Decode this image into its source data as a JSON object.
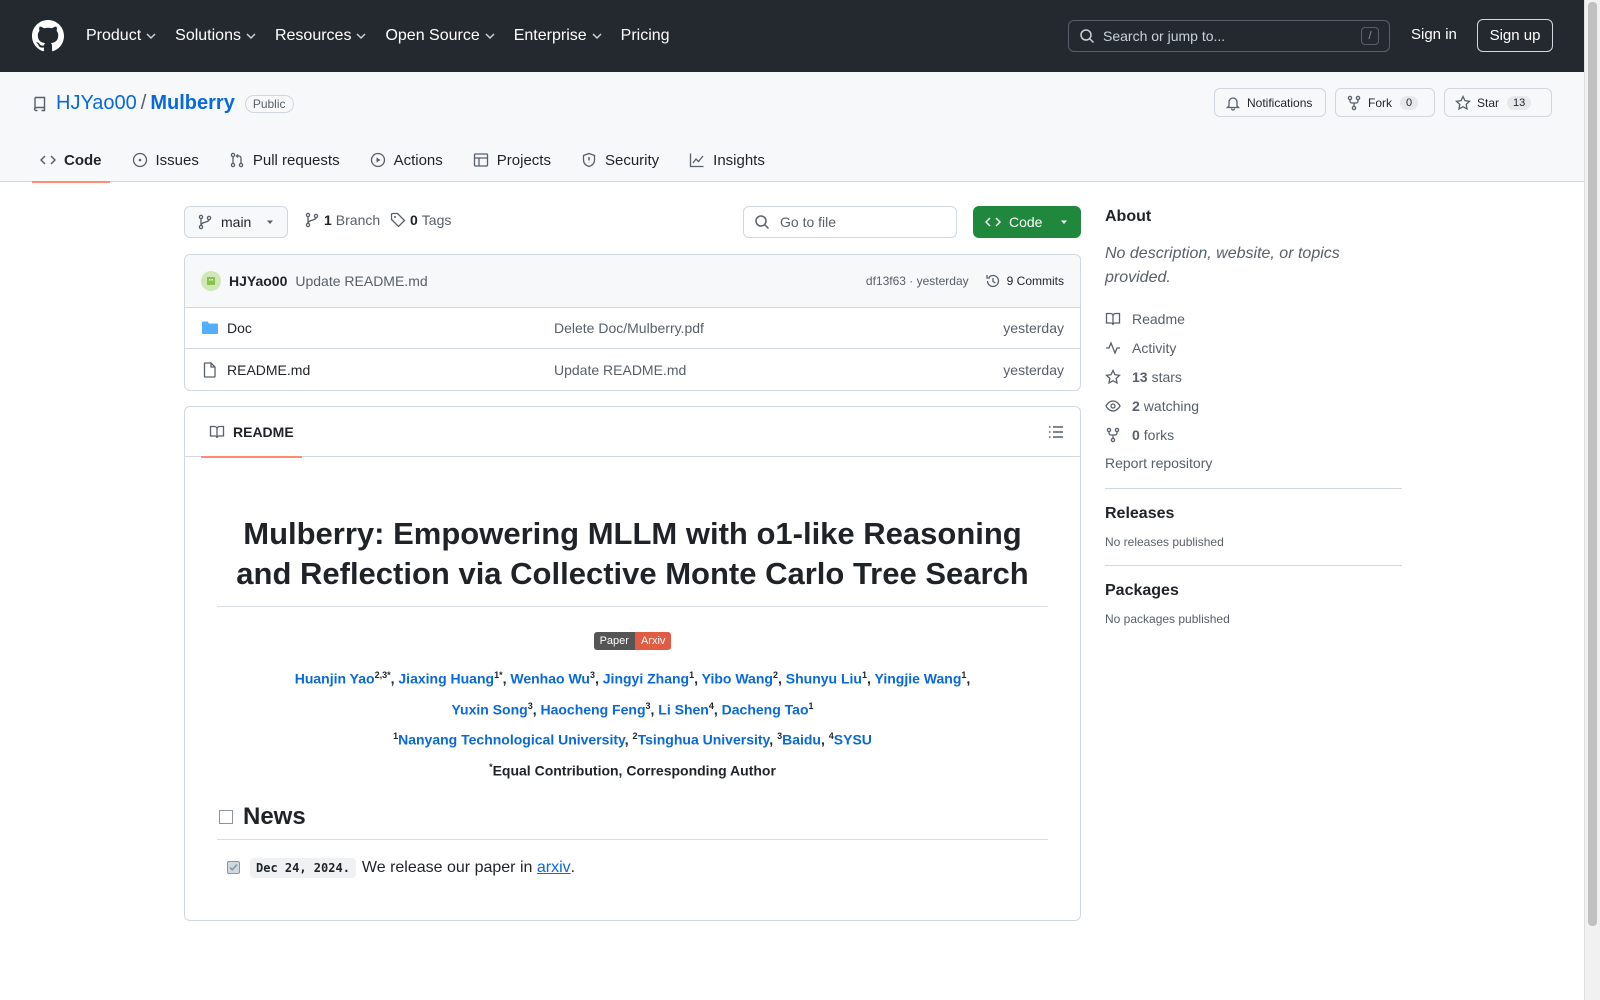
{
  "header": {
    "nav": [
      "Product",
      "Solutions",
      "Resources",
      "Open Source",
      "Enterprise",
      "Pricing"
    ],
    "search_placeholder": "Search or jump to...",
    "search_shortcut": "/",
    "sign_in": "Sign in",
    "sign_up": "Sign up"
  },
  "repo": {
    "owner": "HJYao00",
    "separator": "/",
    "name": "Mulberry",
    "visibility": "Public",
    "notifications_label": "Notifications",
    "fork_label": "Fork",
    "fork_count": "0",
    "star_label": "Star",
    "star_count": "13"
  },
  "tabs": [
    "Code",
    "Issues",
    "Pull requests",
    "Actions",
    "Projects",
    "Security",
    "Insights"
  ],
  "file_nav": {
    "branch": "main",
    "branch_count": "1",
    "branch_label": "Branch",
    "tag_count": "0",
    "tag_label": "Tags",
    "goto_placeholder": "Go to file",
    "code_button": "Code"
  },
  "commit": {
    "author": "HJYao00",
    "message": "Update README.md",
    "hash_time": "df13f63 · yesterday",
    "commits": "9 Commits"
  },
  "files": [
    {
      "name": "Doc",
      "type": "folder",
      "message": "Delete Doc/Mulberry.pdf",
      "date": "yesterday"
    },
    {
      "name": "README.md",
      "type": "file",
      "message": "Update README.md",
      "date": "yesterday"
    }
  ],
  "readme": {
    "tab_label": "README",
    "title": "Mulberry: Empowering MLLM with o1-like Reasoning and Reflection via Collective Monte Carlo Tree Search",
    "badge_left": "Paper",
    "badge_right": "Arxiv",
    "authors_line1": [
      {
        "name": "Huanjin Yao",
        "sup": "2,3*"
      },
      {
        "name": "Jiaxing Huang",
        "sup": "1*"
      },
      {
        "name": "Wenhao Wu",
        "sup": "3"
      },
      {
        "name": "Jingyi Zhang",
        "sup": "1"
      },
      {
        "name": "Yibo Wang",
        "sup": "2"
      },
      {
        "name": "Shunyu Liu",
        "sup": "1"
      },
      {
        "name": "Yingjie Wang",
        "sup": "1"
      }
    ],
    "authors_line2": [
      {
        "name": "Yuxin Song",
        "sup": "3"
      },
      {
        "name": "Haocheng Feng",
        "sup": "3"
      },
      {
        "name": "Li Shen",
        "sup": "4"
      },
      {
        "name": "Dacheng Tao",
        "sup": "1"
      }
    ],
    "affiliations": [
      {
        "sup": "1",
        "name": "Nanyang Technological University"
      },
      {
        "sup": "2",
        "name": "Tsinghua University"
      },
      {
        "sup": "3",
        "name": "Baidu"
      },
      {
        "sup": "4",
        "name": "SYSU"
      }
    ],
    "equal_sup": "*",
    "equal_text": "Equal Contribution,",
    "corresponding_text": "Corresponding Author",
    "news_heading": "News",
    "news_date": "Dec 24, 2024.",
    "news_text": "We release our paper in",
    "news_link": "arxiv",
    "news_end": "."
  },
  "about": {
    "heading": "About",
    "description": "No description, website, or topics provided.",
    "readme": "Readme",
    "activity": "Activity",
    "stars_count": "13",
    "stars_label": "stars",
    "watching_count": "2",
    "watching_label": "watching",
    "forks_count": "0",
    "forks_label": "forks",
    "report": "Report repository"
  },
  "releases": {
    "heading": "Releases",
    "text": "No releases published"
  },
  "packages": {
    "heading": "Packages",
    "text": "No packages published"
  }
}
